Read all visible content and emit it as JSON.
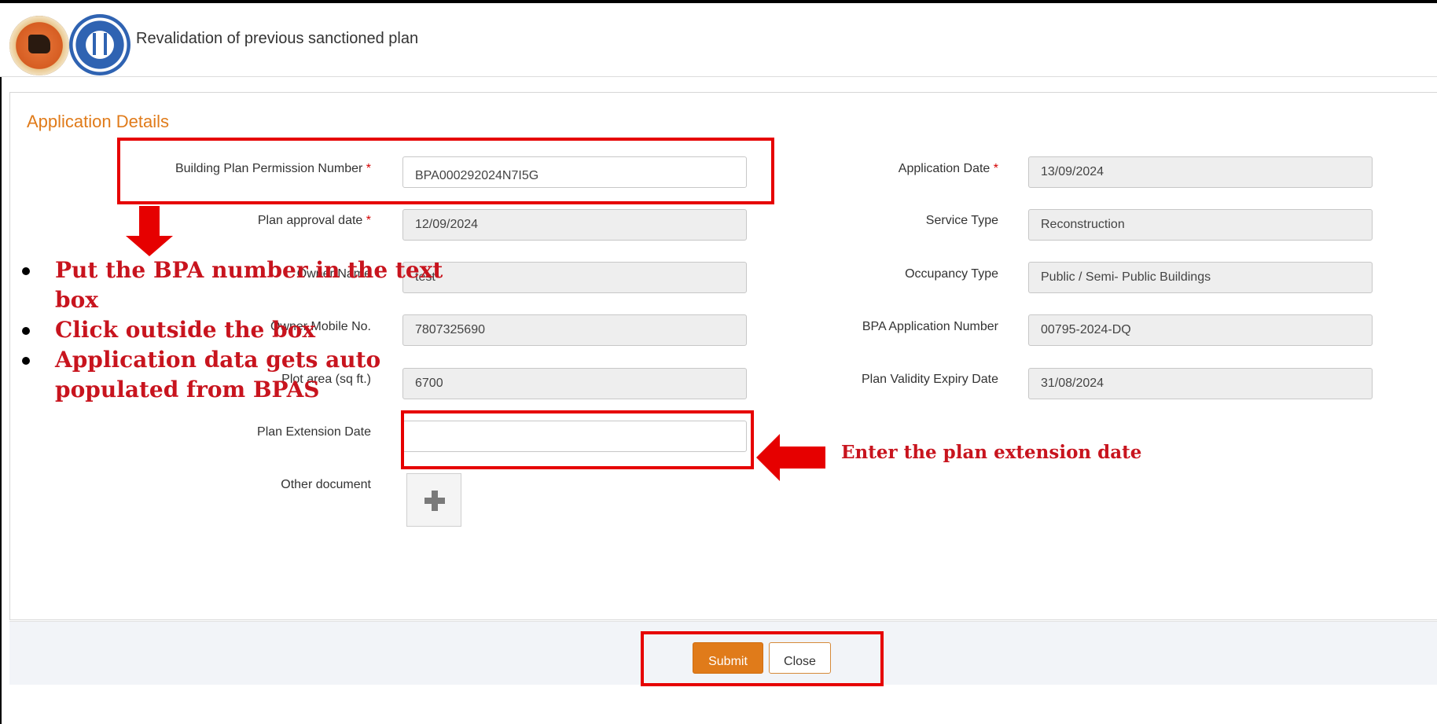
{
  "header": {
    "title": "Revalidation of previous sanctioned plan",
    "logos": [
      "chandigarh-administration-logo",
      "municipal-corporation-chandigarh-logo"
    ]
  },
  "form": {
    "section_title": "Application Details",
    "required_marker": "*",
    "left": [
      {
        "label": "Building Plan Permission Number",
        "required": true,
        "value": "BPA000292024N7I5G",
        "editable": true
      },
      {
        "label": "Plan approval date",
        "required": true,
        "value": "12/09/2024",
        "editable": false
      },
      {
        "label": "Owner Name",
        "required": false,
        "value": "test",
        "editable": false
      },
      {
        "label": "Owner Mobile No.",
        "required": false,
        "value": "7807325690",
        "editable": false
      },
      {
        "label": "Plot area (sq ft.)",
        "required": false,
        "value": "6700",
        "editable": false
      },
      {
        "label": "Plan Extension Date",
        "required": false,
        "value": "",
        "editable": true
      },
      {
        "label": "Other document",
        "required": false
      }
    ],
    "right": [
      {
        "label": "Application Date",
        "required": true,
        "value": "13/09/2024"
      },
      {
        "label": "Service Type",
        "required": false,
        "value": "Reconstruction"
      },
      {
        "label": "Occupancy Type",
        "required": false,
        "value": "Public / Semi- Public Buildings"
      },
      {
        "label": "BPA Application Number",
        "required": false,
        "value": "00795-2024-DQ"
      },
      {
        "label": "Plan Validity Expiry Date",
        "required": false,
        "value": "31/08/2024"
      }
    ]
  },
  "actions": {
    "submit_label": "Submit",
    "close_label": "Close"
  },
  "annotations": {
    "bullets": [
      "Put the BPA number in the text box",
      "Click outside the box",
      "Application data gets auto populated from BPAS"
    ],
    "extension_note": "Enter the plan extension date"
  },
  "colors": {
    "accent": "#e07b1a",
    "annotation_red": "#e60000",
    "required": "#d40000"
  }
}
